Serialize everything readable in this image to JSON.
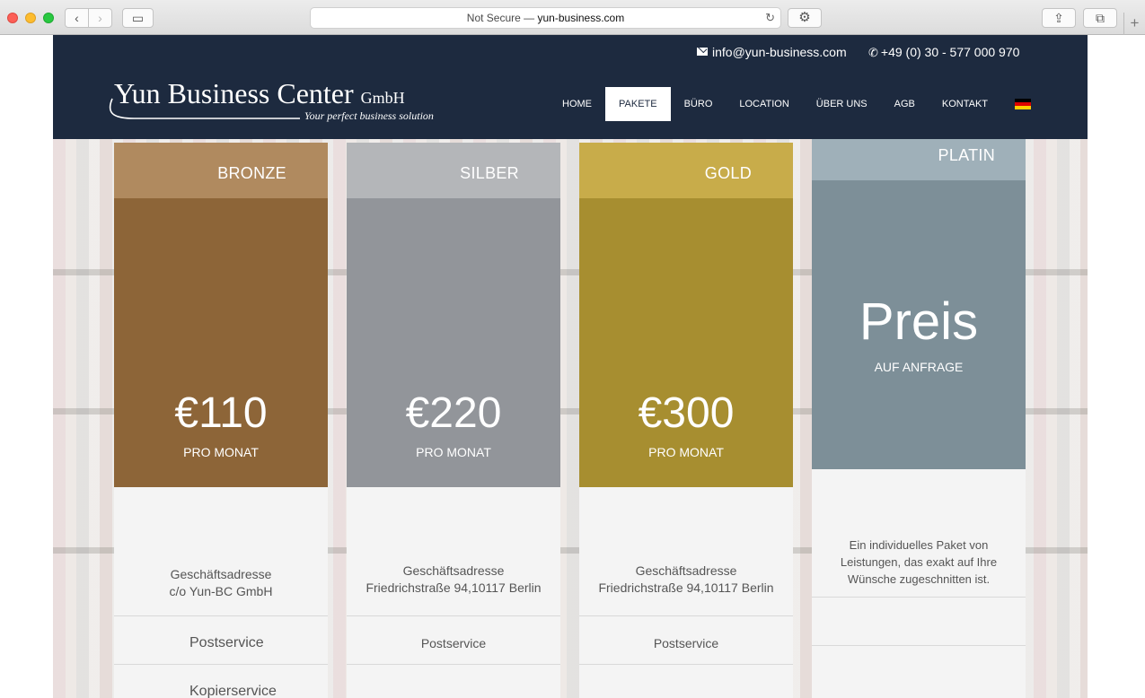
{
  "browser": {
    "address_prefix": "Not Secure —",
    "address_domain": "yun-business.com",
    "reload_icon": "reload-icon",
    "colors": {
      "close": "#fc5f57",
      "minimize": "#fdbc2e",
      "zoom": "#28c840"
    }
  },
  "header": {
    "email": "info@yun-business.com",
    "phone": "+49 (0) 30 - 577 000 970",
    "logo_title": "Yun Business Center",
    "logo_suffix": "GmbH",
    "logo_tagline": "Your perfect business solution",
    "background": "#1d2a3f"
  },
  "nav": [
    {
      "label": "HOME"
    },
    {
      "label": "PAKETE",
      "active": true
    },
    {
      "label": "BÜRO"
    },
    {
      "label": "LOCATION"
    },
    {
      "label": "ÜBER UNS"
    },
    {
      "label": "AGB"
    },
    {
      "label": "KONTAKT"
    }
  ],
  "language_flag": "german-flag-icon",
  "packages": [
    {
      "name": "BRONZE",
      "price": "€110",
      "unit": "PRO MONAT",
      "address_line1": "Geschäftsadresse",
      "address_line2": "c/o Yun-BC GmbH",
      "features": [
        "Postservice",
        "Kopierservice"
      ],
      "header_color": "#b08a5f",
      "body_color": "#8d6538"
    },
    {
      "name": "SILBER",
      "price": "€220",
      "unit": "PRO MONAT",
      "address_line1": "Geschäftsadresse",
      "address_line2": "Friedrichstraße 94,10117 Berlin",
      "features": [
        "Postservice"
      ],
      "header_color": "#b4b6b9",
      "body_color": "#92959a"
    },
    {
      "name": "GOLD",
      "price": "€300",
      "unit": "PRO MONAT",
      "address_line1": "Geschäftsadresse",
      "address_line2": "Friedrichstraße 94,10117 Berlin",
      "features": [
        "Postservice"
      ],
      "header_color": "#c8ac4a",
      "body_color": "#a78e30"
    },
    {
      "name": "PLATIN",
      "price": "Preis",
      "unit": "AUF ANFRAGE",
      "description": "Ein individuelles Paket von Leistungen, das exakt auf Ihre Wünsche zugeschnitten ist.",
      "header_color": "#9fb0b9",
      "body_color": "#7d8f98"
    }
  ]
}
